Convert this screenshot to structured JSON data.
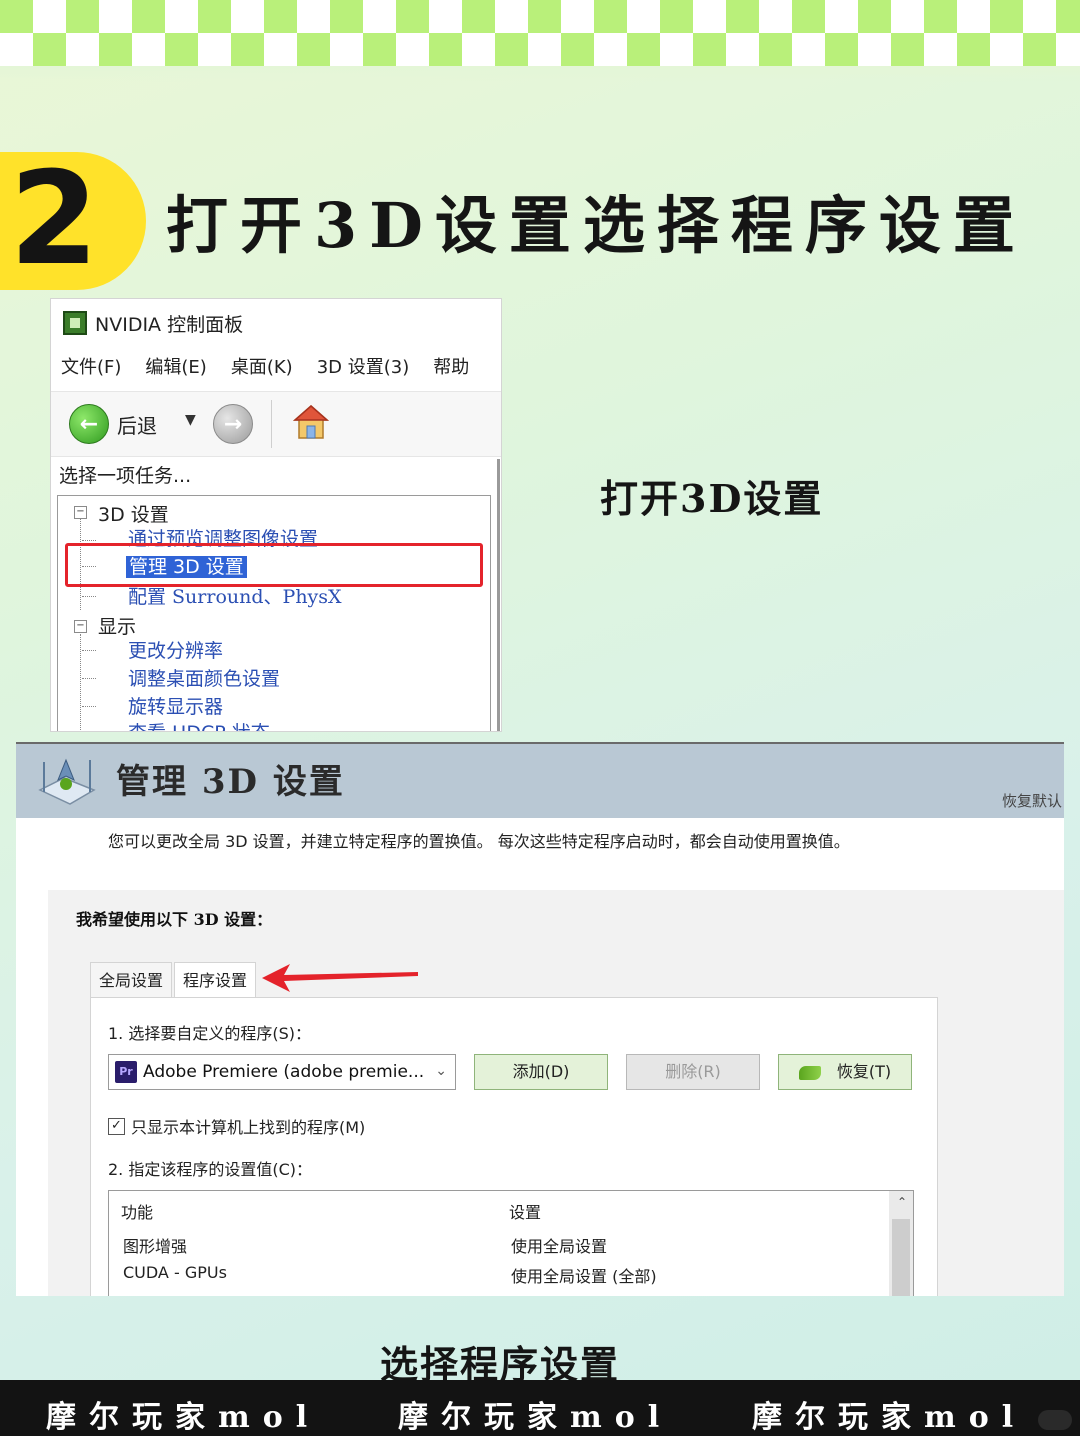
{
  "header": {
    "step_number": "2",
    "title": "打开3D设置选择程序设置"
  },
  "nvidia_panel": {
    "window_title": "NVIDIA 控制面板",
    "menu": [
      "文件(F)",
      "编辑(E)",
      "桌面(K)",
      "3D 设置(3)",
      "帮助"
    ],
    "toolbar": {
      "back_label": "后退"
    },
    "task_label": "选择一项任务...",
    "tree": {
      "group_3d": "3D 设置",
      "item_preview": "通过预览调整图像设置",
      "item_manage": "管理 3D 设置",
      "item_surround": "配置 Surround、PhysX",
      "group_display": "显示",
      "item_resolution": "更改分辨率",
      "item_color": "调整桌面颜色设置",
      "item_rotate": "旋转显示器",
      "item_hdcp": "查看 HDCP 状态"
    }
  },
  "caption_1": "打开3D设置",
  "manage3d": {
    "title": "管理 3D 设置",
    "restore_link": "恢复默认",
    "description": "您可以更改全局 3D 设置，并建立特定程序的置换值。 每次这些特定程序启动时，都会自动使用置换值。",
    "want_label": "我希望使用以下 3D 设置：",
    "tabs": {
      "global": "全局设置",
      "program": "程序设置"
    },
    "step1_label": "1. 选择要自定义的程序(S)：",
    "program_select": {
      "icon": "Pr",
      "value": "Adobe Premiere (adobe premie..."
    },
    "buttons": {
      "add": "添加(D)",
      "remove": "删除(R)",
      "restore": "恢复(T)"
    },
    "checkbox_label": "只显示本计算机上找到的程序(M)",
    "checkbox_checked": true,
    "step2_label": "2. 指定该程序的设置值(C)：",
    "grid": {
      "col_feature": "功能",
      "col_setting": "设置",
      "rows": [
        {
          "feature": "图形增强",
          "setting": "使用全局设置"
        },
        {
          "feature": "CUDA - GPUs",
          "setting": "使用全局设置 (全部)"
        }
      ]
    }
  },
  "caption_2": "选择程序设置",
  "watermark": [
    "摩尔玩家mol",
    "摩尔玩家mol",
    "摩尔玩家mol"
  ],
  "colors": {
    "badge_yellow": "#ffe22a",
    "checker_green": "#b9f07a",
    "highlight_red": "#e4232b",
    "selection_blue": "#2f63d6"
  }
}
